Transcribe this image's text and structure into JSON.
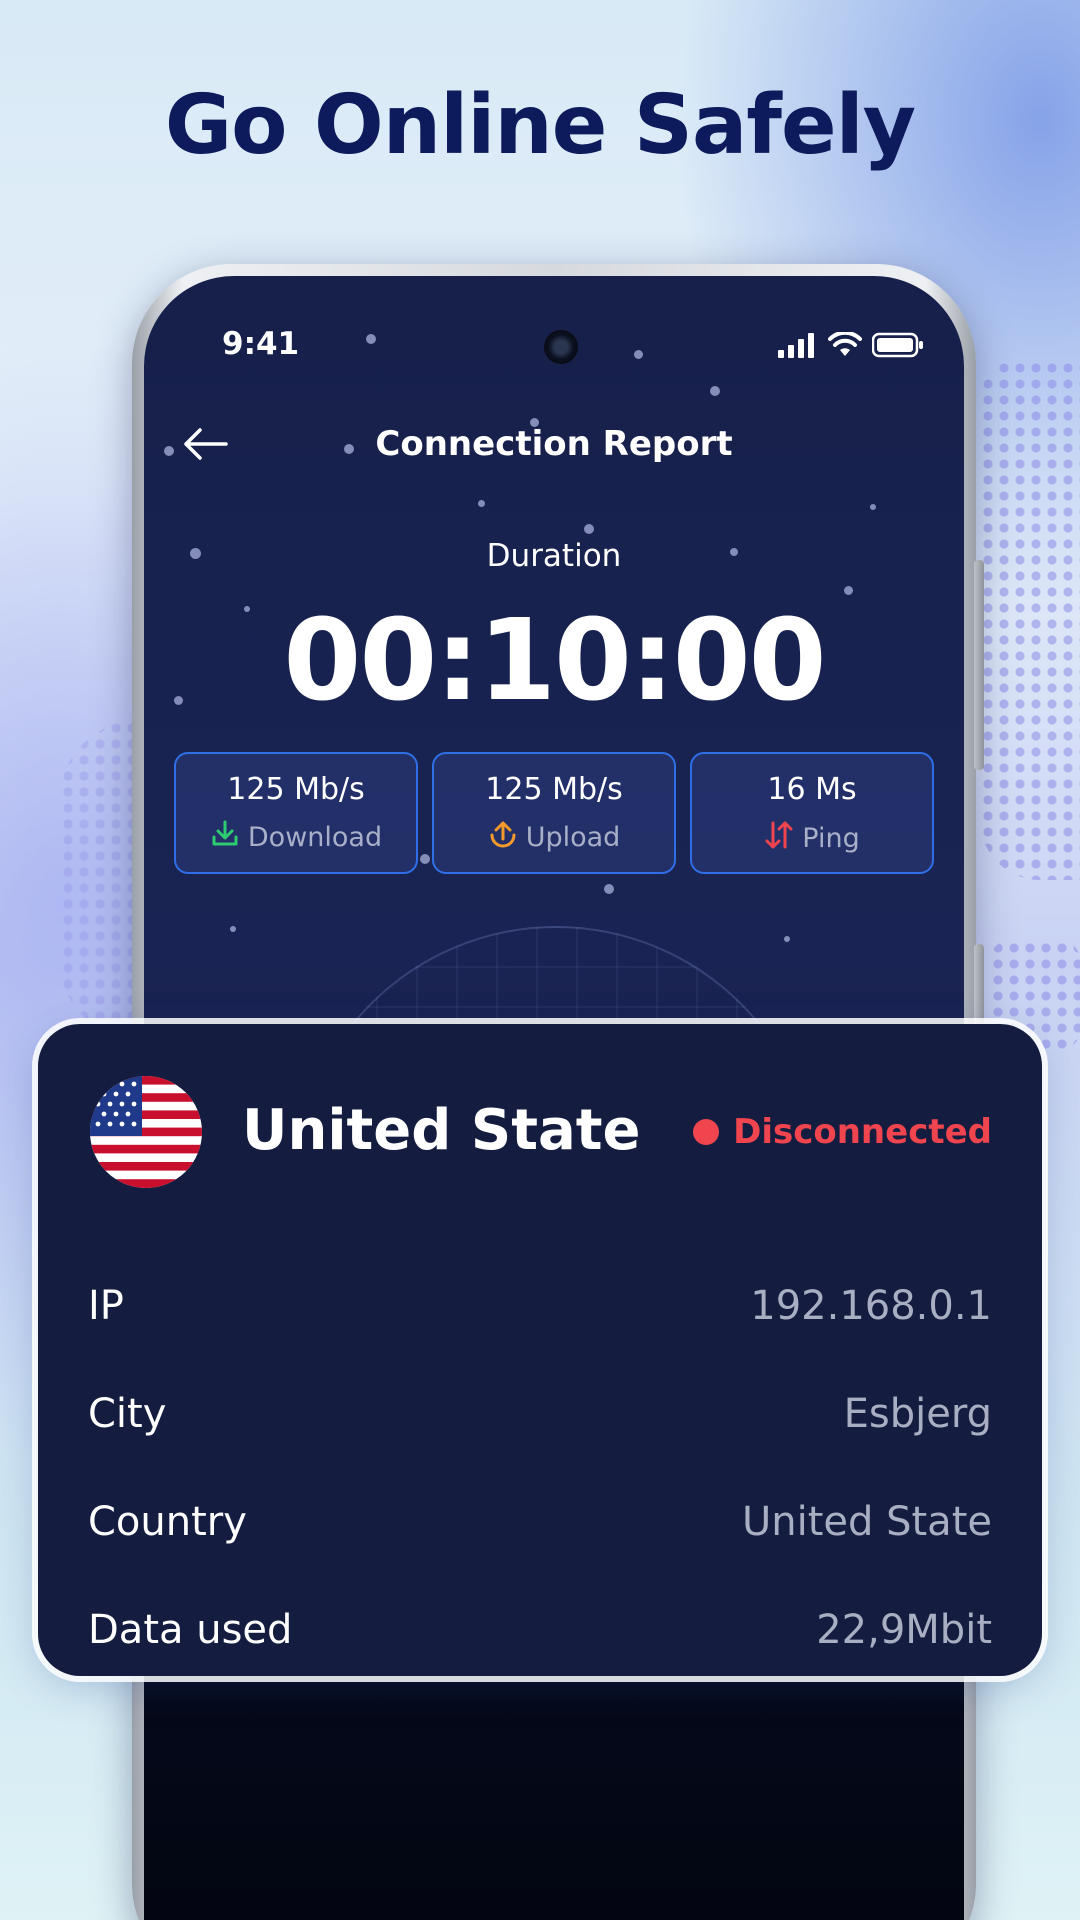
{
  "headline": "Go Online Safely",
  "status_bar": {
    "time": "9:41",
    "icons": [
      "signal-icon",
      "wifi-icon",
      "battery-icon"
    ]
  },
  "nav": {
    "back_icon": "arrow-left-icon",
    "title": "Connection Report"
  },
  "duration": {
    "label": "Duration",
    "value": "00:10:00"
  },
  "stats": [
    {
      "value": "125 Mb/s",
      "label": "Download",
      "icon": "download-icon",
      "color": "#2ecc71"
    },
    {
      "value": "125 Mb/s",
      "label": "Upload",
      "icon": "upload-icon",
      "color": "#f39a2b"
    },
    {
      "value": "16 Ms",
      "label": "Ping",
      "icon": "ping-arrows-icon",
      "color": "#f0454f"
    }
  ],
  "card": {
    "flag_icon": "us-flag-icon",
    "country": "United State",
    "status": "Disconnected",
    "status_color": "#f0454f",
    "rows": [
      {
        "label": "IP",
        "value": "192.168.0.1"
      },
      {
        "label": "City",
        "value": "Esbjerg"
      },
      {
        "label": "Country",
        "value": "United State"
      },
      {
        "label": "Data used",
        "value": "22,9Mbit"
      }
    ]
  },
  "colors": {
    "headline": "#0d1a5c",
    "screen_bg": "#16204a",
    "card_bg": "#141c3f",
    "stat_border": "#2f6fe6"
  }
}
